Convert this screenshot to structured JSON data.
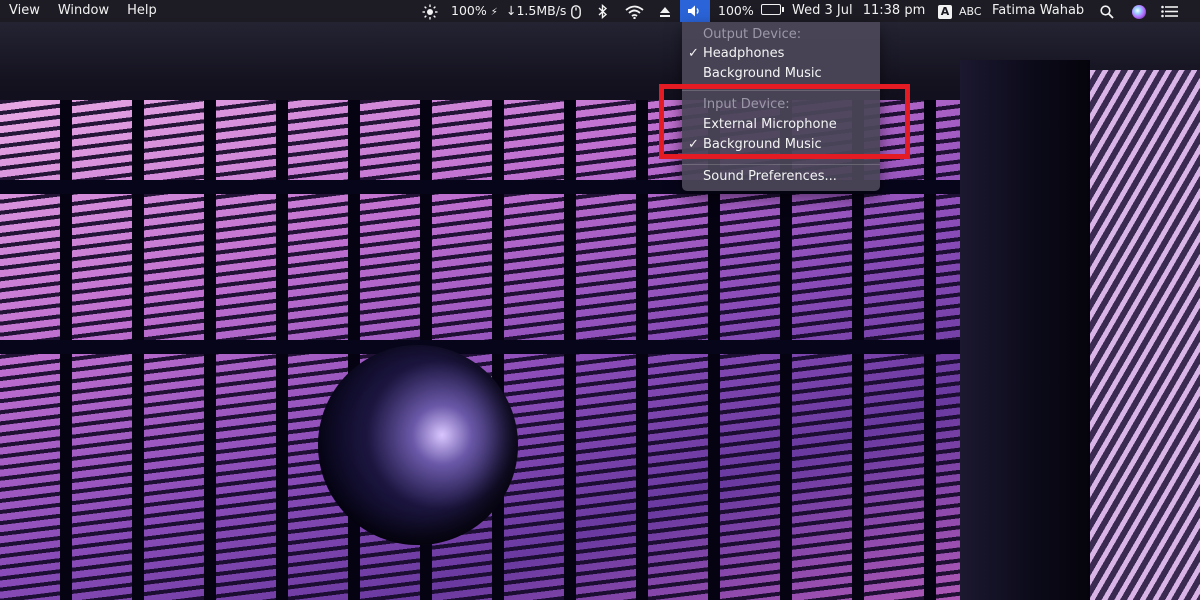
{
  "menubar": {
    "app_menus": [
      "View",
      "Window",
      "Help"
    ],
    "status": {
      "brightness_percent": "100%",
      "charge_glyph": "⚡",
      "network_speed": "↓1.5MB/s",
      "battery_percent": "100%",
      "date": "Wed 3 Jul",
      "time": "11:38 pm",
      "input_source_badge": "A",
      "input_source": "ABC",
      "user_name": "Fatima Wahab"
    }
  },
  "sound_menu": {
    "output_header": "Output Device:",
    "output_devices": [
      {
        "label": "Headphones",
        "checked": true
      },
      {
        "label": "Background Music",
        "checked": false
      }
    ],
    "input_header": "Input Device:",
    "input_devices": [
      {
        "label": "External Microphone",
        "checked": false
      },
      {
        "label": "Background Music",
        "checked": true
      }
    ],
    "preferences_label": "Sound Preferences...",
    "check_glyph": "✓"
  },
  "colors": {
    "highlight_annotation": "#e41b23",
    "menu_selected": "#2b64d9"
  }
}
